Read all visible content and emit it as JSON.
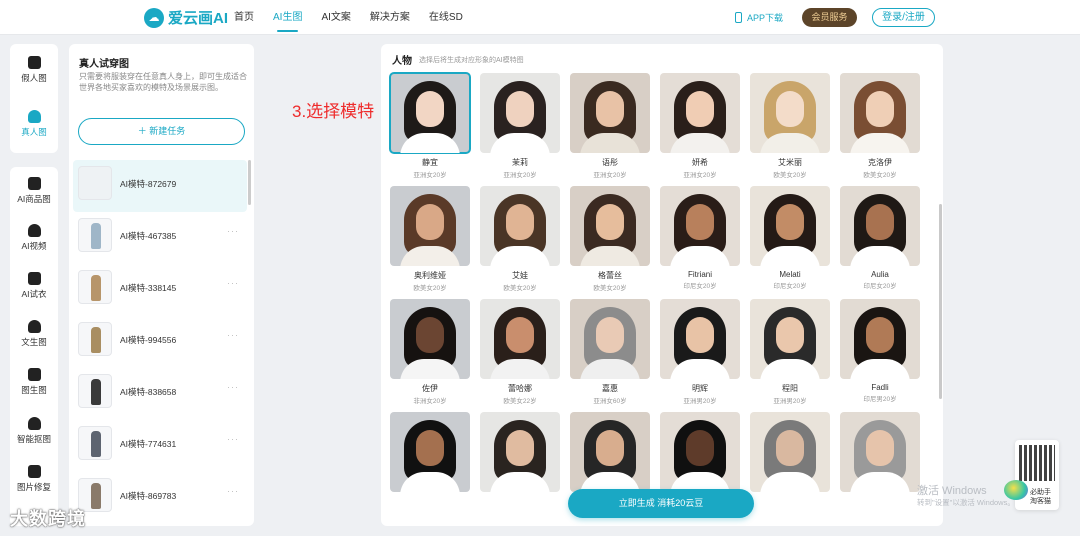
{
  "header": {
    "logo_text": "爱云画AI",
    "nav": [
      "首页",
      "AI生图",
      "AI文案",
      "解决方案",
      "在线SD"
    ],
    "active_nav": 1,
    "app_download": "APP下载",
    "vip": "会员服务",
    "login": "登录/注册"
  },
  "sidebar": {
    "items": [
      {
        "label": "假人图",
        "icon": "mannequin-icon"
      },
      {
        "label": "真人图",
        "icon": "person-icon",
        "active": true
      },
      {
        "label": "AI商品图",
        "icon": "product-icon"
      },
      {
        "label": "AI视频",
        "icon": "video-icon"
      },
      {
        "label": "AI试衣",
        "icon": "tryon-icon"
      },
      {
        "label": "文生图",
        "icon": "text-to-image-icon"
      },
      {
        "label": "图生图",
        "icon": "image-to-image-icon"
      },
      {
        "label": "智能抠图",
        "icon": "cutout-icon"
      },
      {
        "label": "图片修复",
        "icon": "repair-icon"
      }
    ]
  },
  "task_panel": {
    "title": "真人试穿图",
    "description": "只需要将服装穿在任意真人身上，即可生成适合世界各地买家喜欢的模特及场景展示图。",
    "new_task": "新建任务",
    "tasks": [
      {
        "name": "AI模特-872679",
        "selected": true
      },
      {
        "name": "AI模特-467385"
      },
      {
        "name": "AI模特-338145"
      },
      {
        "name": "AI模特-994556"
      },
      {
        "name": "AI模特-838658"
      },
      {
        "name": "AI模特-774631"
      },
      {
        "name": "AI模特-869783"
      }
    ],
    "more": "···"
  },
  "annotation": "3.选择模特",
  "models_panel": {
    "title": "人物",
    "subtitle": "选择后将生成对应形象的AI模特图",
    "models": [
      {
        "name": "静宜",
        "tag": "亚洲女20岁",
        "selected": true
      },
      {
        "name": "茉莉",
        "tag": "亚洲女20岁"
      },
      {
        "name": "语彤",
        "tag": "亚洲女20岁"
      },
      {
        "name": "妍希",
        "tag": "亚洲女20岁"
      },
      {
        "name": "艾米丽",
        "tag": "欧美女20岁"
      },
      {
        "name": "克洛伊",
        "tag": "欧美女20岁"
      },
      {
        "name": "奥利维娅",
        "tag": "欧美女20岁"
      },
      {
        "name": "艾娃",
        "tag": "欧美女20岁"
      },
      {
        "name": "格蕾丝",
        "tag": "欧美女20岁"
      },
      {
        "name": "Fitriani",
        "tag": "印尼女20岁"
      },
      {
        "name": "Melati",
        "tag": "印尼女20岁"
      },
      {
        "name": "Aulia",
        "tag": "印尼女20岁"
      },
      {
        "name": "佐伊",
        "tag": "非洲女20岁"
      },
      {
        "name": "蕾哈娜",
        "tag": "欧美女22岁"
      },
      {
        "name": "嘉惠",
        "tag": "亚洲女60岁"
      },
      {
        "name": "明辉",
        "tag": "亚洲男20岁"
      },
      {
        "name": "程阳",
        "tag": "亚洲男20岁"
      },
      {
        "name": "Fadli",
        "tag": "印尼男20岁"
      },
      {
        "name": "",
        "tag": ""
      },
      {
        "name": "",
        "tag": ""
      },
      {
        "name": "",
        "tag": ""
      },
      {
        "name": "",
        "tag": ""
      },
      {
        "name": "",
        "tag": ""
      },
      {
        "name": "",
        "tag": ""
      }
    ]
  },
  "generate_button": "立即生成  消耗20云豆",
  "float": {
    "qr_label": "扫码关注",
    "helper": "必助手\n淘客猫"
  },
  "watermark": {
    "line1": "激活 Windows",
    "line2": "转到\"设置\"以激活 Windows。"
  },
  "bottom_logo": "大数跨境"
}
